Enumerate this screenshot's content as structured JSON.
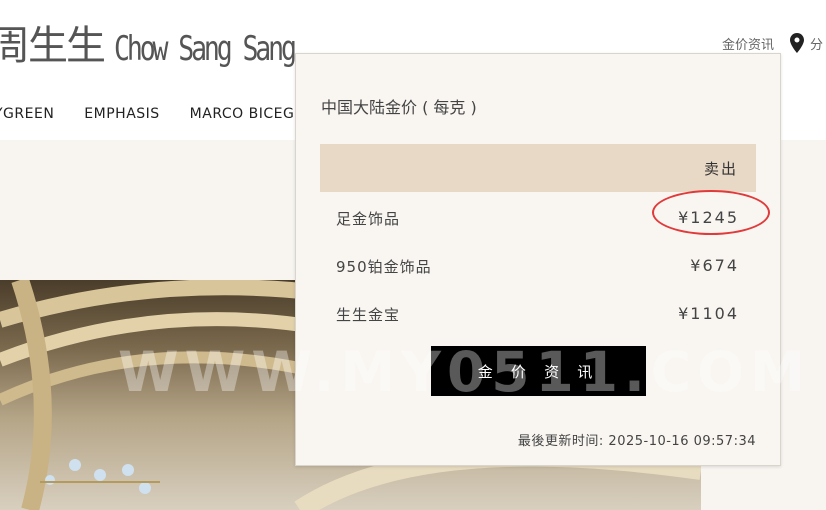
{
  "header": {
    "logo_cn": "周生生",
    "logo_en": "Chow Sang Sang",
    "gold_info_link": "金价资讯",
    "location_partial": "分"
  },
  "nav": {
    "items": [
      "YGREEN",
      "EMPHASIS",
      "MARCO BICEGO"
    ]
  },
  "popup": {
    "title": "中国大陆金价 ( 每克 )",
    "column_header": "卖出",
    "rows": [
      {
        "name": "足金饰品",
        "price": "¥1245"
      },
      {
        "name": "950铂金饰品",
        "price": "¥674"
      },
      {
        "name": "生生金宝",
        "price": "¥1104"
      }
    ],
    "button_label": "金 价 资 讯",
    "updated": "最後更新时间: 2025-10-16 09:57:34"
  },
  "watermark": "WWW.MY0511.COM",
  "colors": {
    "popup_bg": "#f9f6f2",
    "header_bg": "#e8d9c6",
    "highlight": "#e03a3a"
  }
}
